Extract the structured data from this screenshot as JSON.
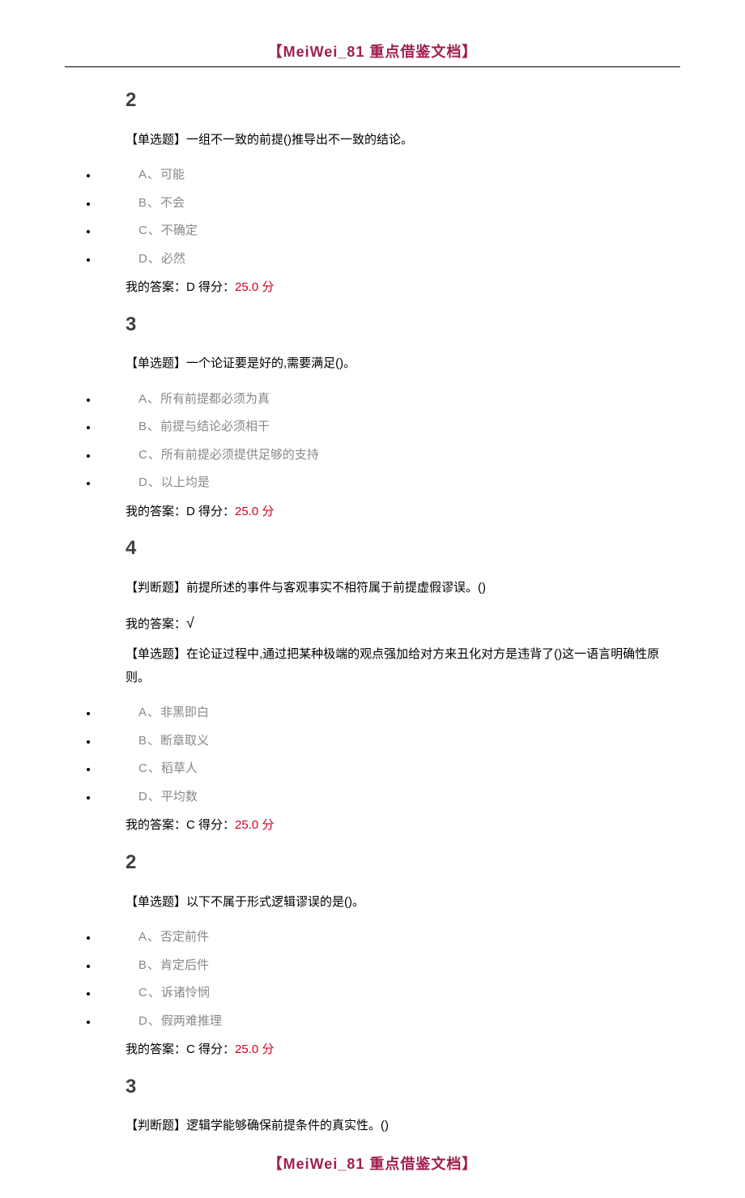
{
  "header": "【MeiWei_81 重点借鉴文档】",
  "footer": "【MeiWei_81 重点借鉴文档】",
  "score_text": "25.0 分",
  "answer_prefix": "我的答案：",
  "score_prefix": " 得分：",
  "questions": [
    {
      "num": "2",
      "tag": "【单选题】",
      "text": "一组不一致的前提()推导出不一致的结论。",
      "options": [
        {
          "label": "A、",
          "text": "可能"
        },
        {
          "label": "B、",
          "text": "不会"
        },
        {
          "label": "C、",
          "text": "不确定"
        },
        {
          "label": "D、",
          "text": "必然"
        }
      ],
      "answer": "D",
      "show_score": true
    },
    {
      "num": "3",
      "tag": "【单选题】",
      "text": "一个论证要是好的,需要满足()。",
      "options": [
        {
          "label": "A、",
          "text": "所有前提都必须为真"
        },
        {
          "label": "B、",
          "text": "前提与结论必须相干"
        },
        {
          "label": "C、",
          "text": "所有前提必须提供足够的支持"
        },
        {
          "label": "D、",
          "text": "以上均是"
        }
      ],
      "answer": "D",
      "show_score": true
    },
    {
      "num": "4",
      "tag": "【判断题】",
      "text": "前提所述的事件与客观事实不相符属于前提虚假谬误。()",
      "options": [],
      "answer": "√",
      "show_score": false
    },
    {
      "num": "",
      "tag": "【单选题】",
      "text": "在论证过程中,通过把某种极端的观点强加给对方来丑化对方是违背了()这一语言明确性原则。",
      "options": [
        {
          "label": "A、",
          "text": "非黑即白"
        },
        {
          "label": "B、",
          "text": "断章取义"
        },
        {
          "label": "C、",
          "text": "稻草人"
        },
        {
          "label": "D、",
          "text": "平均数"
        }
      ],
      "answer": "C",
      "show_score": true
    },
    {
      "num": "2",
      "tag": "【单选题】",
      "text": "以下不属于形式逻辑谬误的是()。",
      "options": [
        {
          "label": "A、",
          "text": "否定前件"
        },
        {
          "label": "B、",
          "text": "肯定后件"
        },
        {
          "label": "C、",
          "text": "诉诸怜悯"
        },
        {
          "label": "D、",
          "text": "假两难推理"
        }
      ],
      "answer": "C",
      "show_score": true
    },
    {
      "num": "3",
      "tag": "【判断题】",
      "text": "逻辑学能够确保前提条件的真实性。()",
      "options": [],
      "answer": "",
      "show_score": false
    }
  ]
}
